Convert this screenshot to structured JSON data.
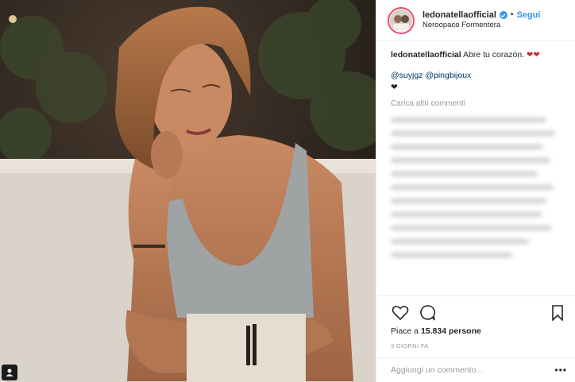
{
  "header": {
    "username": "ledonatellaofficial",
    "separator": "•",
    "follow_label": "Segui",
    "location": "Neroopaco Formentera"
  },
  "caption": {
    "username": "ledonatellaofficial",
    "text": "Abre tu corazón.",
    "mentions": "@suyjgz @pingbijoux"
  },
  "load_more_label": "Carica altri commenti",
  "likes": {
    "prefix": "Piace a",
    "count": "15.834 persone"
  },
  "time_label": "3 GIORNI FA",
  "comment_placeholder": "Aggiungi un commento...",
  "icons": {
    "like": "heart-outline-icon",
    "comment": "speech-bubble-icon",
    "save": "bookmark-icon",
    "more": "more-options-icon",
    "verified": "verified-badge-icon",
    "user_tag": "user-tag-icon"
  },
  "colors": {
    "accent_blue": "#3897f0",
    "mention_blue": "#003569",
    "muted_gray": "#999999",
    "border": "#efefef",
    "story_ring": "#ea4c6b"
  }
}
